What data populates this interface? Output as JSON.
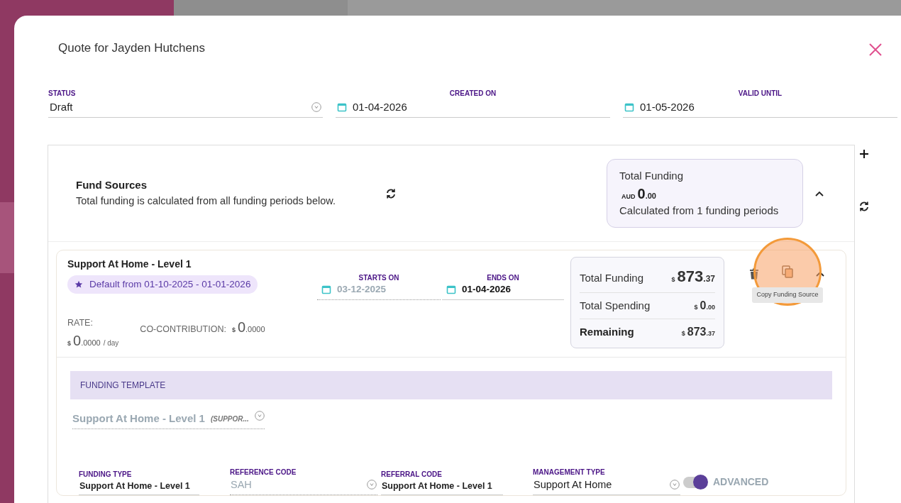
{
  "dialog": {
    "title": "Quote for Jayden Hutchens"
  },
  "fields": [
    {
      "label": "STATUS",
      "value": "Draft",
      "kind": "select"
    },
    {
      "label": "CREATED ON",
      "value": "01-04-2026",
      "kind": "date"
    },
    {
      "label": "VALID UNTIL",
      "value": "01-05-2026",
      "kind": "date"
    }
  ],
  "fund_sources": {
    "title": "Fund Sources",
    "description": "Total funding is calculated from all funding periods below.",
    "expanded": true,
    "summary": {
      "label": "Total Funding",
      "currency": "AUD",
      "whole": "0",
      "cents": ".00",
      "note": "Calculated from 1 funding periods"
    }
  },
  "funding_period": {
    "name": "Support At Home - Level 1",
    "badge": "Default from 01-10-2025 - 01-01-2026",
    "expanded": true,
    "dates": [
      {
        "label": "STARTS ON",
        "value": "03-12-2025",
        "disabled": true
      },
      {
        "label": "ENDS ON",
        "value": "01-04-2026",
        "disabled": false
      }
    ],
    "rate": {
      "label": "RATE:",
      "currency": "$",
      "whole": "0",
      "decimals": ".0000",
      "unit": "/ day"
    },
    "co_contribution": {
      "label": "CO-CONTRIBUTION:",
      "currency": "$",
      "whole": "0",
      "decimals": ".0000"
    },
    "totals": [
      {
        "label": "Total Funding",
        "currency": "$",
        "whole": "873",
        "cents": ".37",
        "kind": "large"
      },
      {
        "label": "Total Spending",
        "currency": "$",
        "whole": "0",
        "cents": ".00",
        "kind": "normal"
      },
      {
        "label": "Remaining",
        "currency": "$",
        "whole": "873",
        "cents": ".37",
        "kind": "bold"
      }
    ],
    "tooltip": "Copy Funding Source"
  },
  "template": {
    "header": "FUNDING TEMPLATE",
    "value": "Support At Home - Level 1",
    "suffix": "(SUPPOR...",
    "disabled": true,
    "fields": [
      {
        "label": "FUNDING TYPE",
        "value": "Support At Home - Level 1",
        "kind": "text",
        "disabled": false
      },
      {
        "label": "REFERENCE CODE",
        "value": "SAH",
        "kind": "select",
        "disabled": true
      },
      {
        "label": "REFERRAL CODE",
        "value": "Support At Home - Level 1",
        "kind": "text",
        "disabled": false
      },
      {
        "label": "MANAGEMENT TYPE",
        "value": "Support At Home",
        "kind": "select",
        "disabled": false
      }
    ],
    "advanced": {
      "label": "ADVANCED",
      "on": true
    }
  }
}
